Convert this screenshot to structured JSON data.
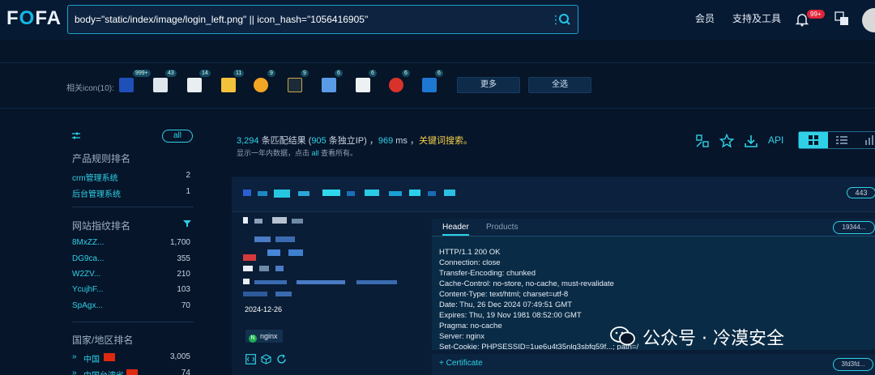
{
  "app": {
    "logo_text": "FOFA",
    "search_value": "body=\"static/index/image/login_left.png\" || icon_hash=\"1056416905\"",
    "nav": {
      "member": "会员",
      "support": "支持及工具",
      "notif_count": "99+"
    }
  },
  "icons_row": {
    "label": "相关icon(10):",
    "counts": [
      "999+",
      "43",
      "14",
      "11",
      "9",
      "9",
      "6",
      "6",
      "6",
      "6"
    ],
    "more_label": "更多",
    "select_all_label": "全选"
  },
  "sidebar": {
    "all_label": "all",
    "product_title": "产品规则排名",
    "products": [
      {
        "name": "crm管理系统",
        "count": "2"
      },
      {
        "name": "后台管理系统",
        "count": "1"
      }
    ],
    "fingerprint_title": "网站指纹排名",
    "fingerprints": [
      {
        "name": "8MxZZ...",
        "count": "1,700"
      },
      {
        "name": "DG9ca...",
        "count": "355"
      },
      {
        "name": "W2ZV...",
        "count": "210"
      },
      {
        "name": "YcujhF...",
        "count": "103"
      },
      {
        "name": "SpAgx...",
        "count": "70"
      }
    ],
    "country_title": "国家/地区排名",
    "countries": [
      {
        "name": "中国",
        "count": "3,005"
      },
      {
        "name": "中国台湾省",
        "count": "74"
      }
    ]
  },
  "results": {
    "total": "3,294",
    "match_text": " 条匹配结果 (",
    "ip_count": "905",
    "ip_text": " 条独立IP) ，",
    "time": "969",
    "time_text": " ms ，",
    "keyword_search": "关键词搜索。",
    "note_prefix": "显示一年内数据，点击 ",
    "note_all": "all",
    "note_suffix": " 查看所有。",
    "api_label": "API"
  },
  "card": {
    "port": "443",
    "date": "2024-12-26",
    "server_tag": "nginx",
    "tab_header": "Header",
    "tab_products": "Products",
    "hash_pill": "19344...",
    "header_lines": [
      "HTTP/1.1 200 OK",
      "Connection: close",
      "Transfer-Encoding: chunked",
      "Cache-Control: no-store, no-cache, must-revalidate",
      "Content-Type: text/html; charset=utf-8",
      "Date: Thu, 26 Dec 2024 07:49:51 GMT",
      "Expires: Thu, 19 Nov 1981 08:52:00 GMT",
      "Pragma: no-cache",
      "Server: nginx",
      "Set-Cookie: PHPSESSID=1ue6u4t35nlq3sbfq59f...; path=/"
    ],
    "cert_label": "+ Certificate",
    "cert_pill": "3fd3fd..."
  },
  "watermark": "公众号 · 冷漠安全",
  "colors": {
    "accent": "#2fd1e6",
    "keyword": "#f5d04a",
    "background": "#06152a"
  }
}
